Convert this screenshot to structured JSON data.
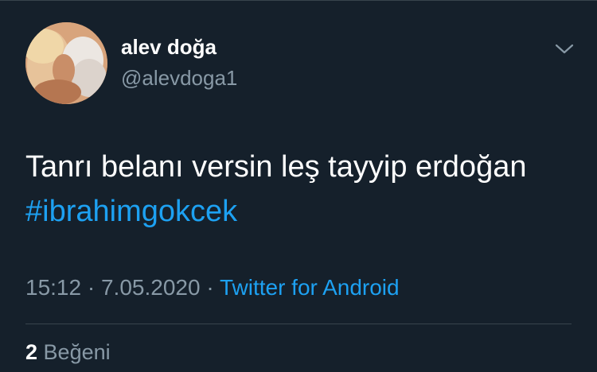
{
  "author": {
    "display_name": "alev doğa",
    "handle": "@alevdoga1"
  },
  "tweet": {
    "text_line1": "Tanrı belanı versin leş tayyip erdoğan",
    "hashtag": "#ibrahimgokcek"
  },
  "meta": {
    "time": "15:12",
    "separator": "·",
    "date": "7.05.2020",
    "source": "Twitter for Android"
  },
  "stats": {
    "likes_count": "2",
    "likes_label": "Beğeni"
  },
  "icons": {
    "more": "chevron-down-icon",
    "avatar": "avatar-photo"
  },
  "colors": {
    "background": "#15202b",
    "accent": "#1da1f2",
    "secondary_text": "#8899a6",
    "divider": "#38444d"
  }
}
